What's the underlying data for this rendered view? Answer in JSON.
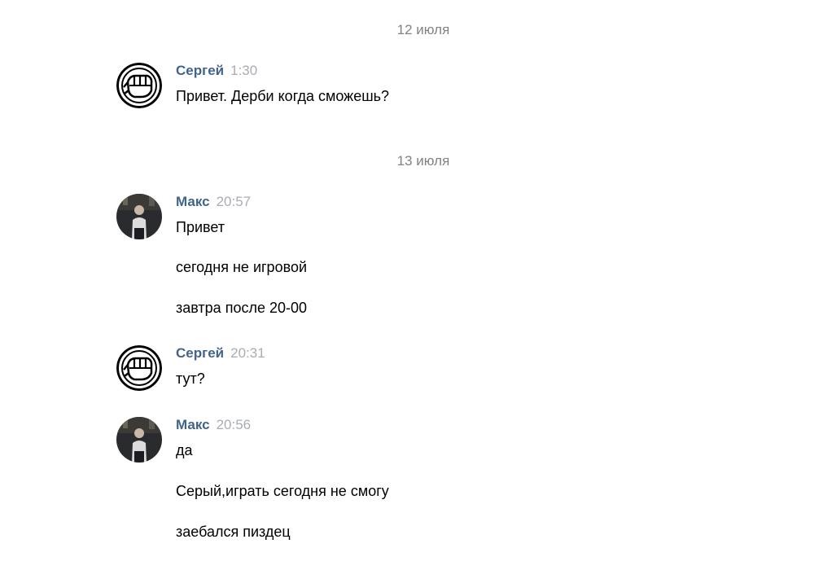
{
  "colors": {
    "author": "#42648b",
    "time": "#a8adb3",
    "date": "#828282",
    "text": "#000000"
  },
  "dates": [
    "12 июля",
    "13 июля"
  ],
  "messages": [
    {
      "author": "Сергей",
      "avatar_icon": "fist-icon",
      "time": "1:30",
      "lines": [
        "Привет. Дерби когда сможешь?"
      ]
    },
    {
      "author": "Макс",
      "avatar_icon": "user-photo",
      "time": "20:57",
      "lines": [
        "Привет",
        "сегодня не игровой",
        "завтра после 20-00"
      ]
    },
    {
      "author": "Сергей",
      "avatar_icon": "fist-icon",
      "time": "20:31",
      "lines": [
        "тут?"
      ]
    },
    {
      "author": "Макс",
      "avatar_icon": "user-photo",
      "time": "20:56",
      "lines": [
        "да",
        "Серый,играть сегодня не смогу",
        "заебался пиздец"
      ]
    }
  ]
}
